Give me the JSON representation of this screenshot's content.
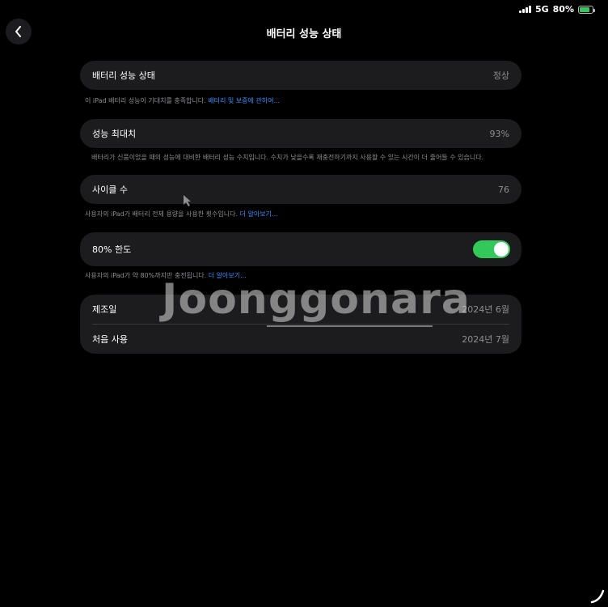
{
  "status_bar": {
    "network": "5G",
    "battery_percent": "80%",
    "battery_level": 0.8
  },
  "header": {
    "title": "배터리 성능 상태"
  },
  "health": {
    "label": "배터리 성능 상태",
    "value": "정상",
    "footnote_text": "이 iPad 배터리 성능이 기대치를 충족합니다. ",
    "footnote_link": "배터리 및 보증에 관하여..."
  },
  "max_capacity": {
    "label": "성능 최대치",
    "value": "93%",
    "footnote_text": "배터리가 신품이었을 때의 성능에 대비한 배터리 성능 수치입니다. 수치가 낮을수록 재충전하기까지 사용할 수 있는 시간이 더 줄어들 수 있습니다."
  },
  "cycle_count": {
    "label": "사이클 수",
    "value": "76",
    "footnote_text": "사용자의 iPad가 배터리 전체 용량을 사용한 횟수입니다. ",
    "footnote_link": "더 알아보기..."
  },
  "limit_80": {
    "label": "80% 한도",
    "enabled": true,
    "footnote_text": "사용자의 iPad가 약 80%까지만 충전됩니다. ",
    "footnote_link": "더 알아보기..."
  },
  "dates": {
    "manufactured_label": "제조일",
    "manufactured_value": "2024년 6월",
    "first_use_label": "처음 사용",
    "first_use_value": "2024년 7월"
  },
  "watermark": {
    "text": "Joonggonara"
  },
  "colors": {
    "accent_link": "#3b8cf7",
    "toggle_on": "#34c759",
    "card_bg": "#1c1c1e"
  }
}
